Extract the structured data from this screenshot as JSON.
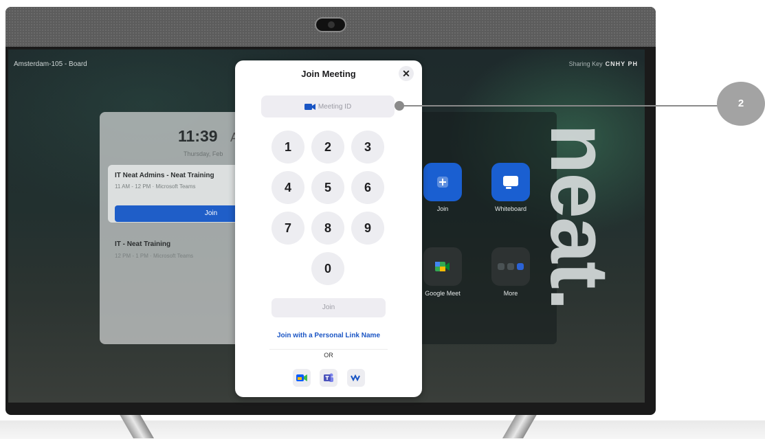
{
  "screen": {
    "room_name": "Amsterdam-105 - Board",
    "sharing_key_label": "Sharing Key",
    "sharing_key_value": "CNHY PH"
  },
  "home": {
    "clock_time": "11:39",
    "clock_ampm": "A",
    "date": "Thursday, Feb",
    "meetings": [
      {
        "title": "IT Neat Admins - Neat Training",
        "subtitle": "11 AM - 12 PM · Microsoft Teams",
        "join_label": "Join"
      },
      {
        "title": "IT - Neat Training",
        "subtitle": "12 PM - 1 PM · Microsoft Teams"
      }
    ],
    "apps": [
      {
        "label": "Join",
        "icon": "plus-icon"
      },
      {
        "label": "Whiteboard",
        "icon": "whiteboard-icon"
      },
      {
        "label": "Google Meet",
        "icon": "google-meet-icon"
      },
      {
        "label": "More",
        "icon": "more-apps-icon"
      }
    ],
    "brand": "neat."
  },
  "modal": {
    "title": "Join Meeting",
    "close_icon": "close-icon",
    "meeting_id_placeholder": "Meeting ID",
    "keys": [
      "1",
      "2",
      "3",
      "4",
      "5",
      "6",
      "7",
      "8",
      "9",
      "0"
    ],
    "join_label": "Join",
    "personal_link_label": "Join with a Personal Link Name",
    "or_label": "OR",
    "services": [
      "zoom-icon",
      "teams-icon",
      "webex-icon"
    ]
  },
  "callout": {
    "number": "2"
  },
  "colors": {
    "accent": "#1a55c4",
    "join_blue": "#1f5ec8",
    "callout_gray": "#a3a3a3"
  }
}
